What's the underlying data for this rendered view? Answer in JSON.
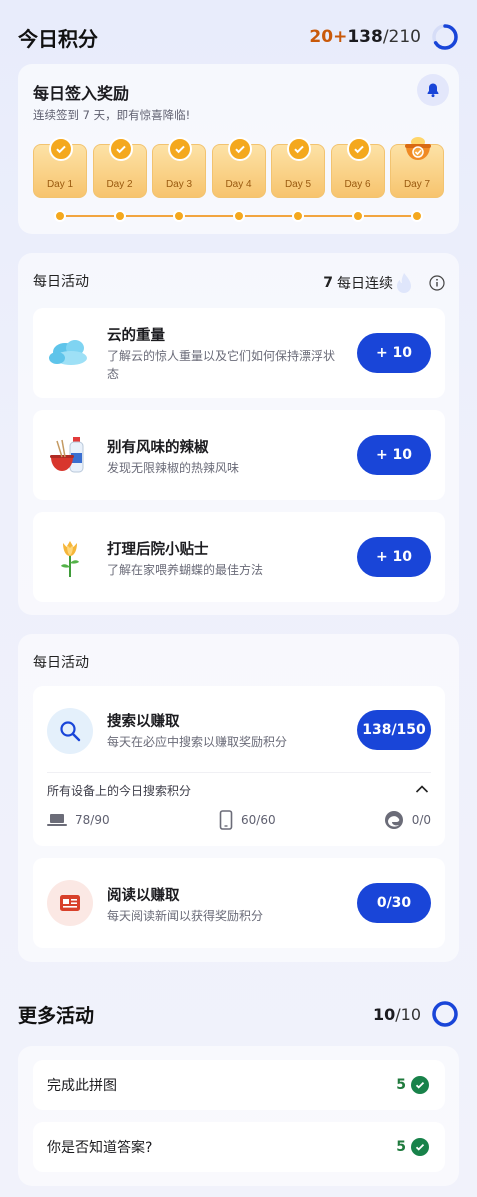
{
  "header": {
    "title": "今日积分",
    "bonus": "20+",
    "current": "138",
    "total": "/210",
    "progress": 0.657
  },
  "signin": {
    "title": "每日签入奖励",
    "subtitle": "连续签到 7 天，即有惊喜降临!",
    "days": [
      "Day 1",
      "Day 2",
      "Day 3",
      "Day 4",
      "Day 5",
      "Day 6",
      "Day 7"
    ]
  },
  "daily": {
    "label": "每日活动",
    "streak_count": "7",
    "streak_label": "每日连续",
    "activities": [
      {
        "title": "云的重量",
        "desc": "了解云的惊人重量以及它们如何保持漂浮状态",
        "points": "+ 10",
        "icon": "cloud-icon"
      },
      {
        "title": "别有风味的辣椒",
        "desc": "发现无限辣椒的热辣风味",
        "points": "+ 10",
        "icon": "noodle-bottle-icon"
      },
      {
        "title": "打理后院小贴士",
        "desc": "了解在家喂养蝴蝶的最佳方法",
        "points": "+ 10",
        "icon": "flower-icon"
      }
    ]
  },
  "earn": {
    "label": "每日活动",
    "search": {
      "title": "搜索以赚取",
      "desc": "每天在必应中搜索以赚取奖励积分",
      "points": "138/150",
      "devices_label": "所有设备上的今日搜索积分",
      "pc": "78/90",
      "mobile": "60/60",
      "edge": "0/0"
    },
    "read": {
      "title": "阅读以赚取",
      "desc": "每天阅读新闻以获得奖励积分",
      "points": "0/30"
    }
  },
  "more": {
    "title": "更多活动",
    "current": "10",
    "total": "/10",
    "progress": 1.0,
    "items": [
      {
        "label": "完成此拼图",
        "points": "5"
      },
      {
        "label": "你是否知道答案?",
        "points": "5"
      }
    ]
  },
  "colors": {
    "accent": "#1945d8",
    "bonus": "#c9590a",
    "gold": "#f4a81e",
    "success": "#18824a"
  }
}
